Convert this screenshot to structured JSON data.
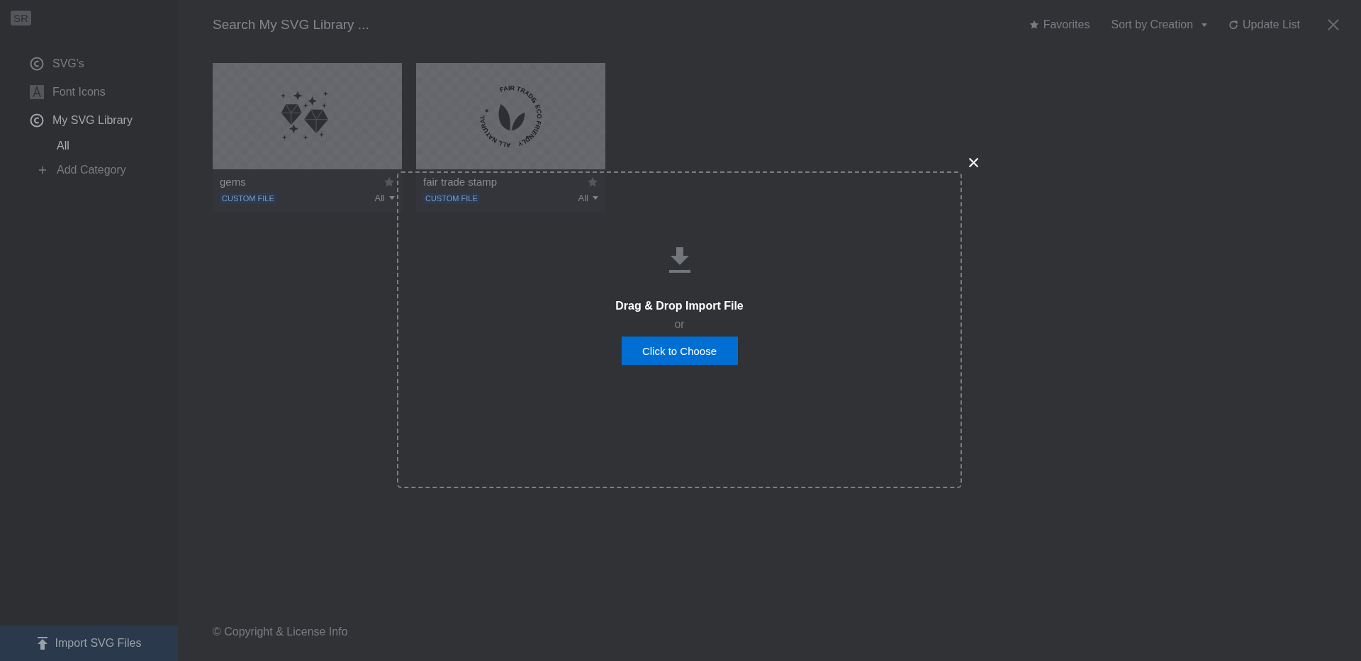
{
  "sidebar": {
    "logo": "SR",
    "nav": [
      {
        "label": "SVG's",
        "kind": "copyright",
        "selected": false
      },
      {
        "label": "Font Icons",
        "kind": "font",
        "selected": false
      },
      {
        "label": "My SVG Library",
        "kind": "copyright",
        "selected": true,
        "children": [
          {
            "label": "All",
            "selected": true
          }
        ]
      }
    ],
    "add_category": "Add Category",
    "import_button": "Import SVG Files"
  },
  "toolbar": {
    "search": {
      "placeholder": "Search My SVG Library ..."
    },
    "favorites": "Favorites",
    "sort": "Sort by Creation",
    "update": "Update List"
  },
  "cards": [
    {
      "name": "gems",
      "kind": "gems",
      "badge": "CUSTOM FILE",
      "category": "All",
      "favorite": false
    },
    {
      "name": "fair trade stamp",
      "kind": "stamp",
      "stamp_texts": [
        "ALL NATURAL",
        "FAIR TRADE",
        "ECO FRIENDLY"
      ],
      "badge": "CUSTOM FILE",
      "category": "All",
      "favorite": false
    }
  ],
  "footer": "© Copyright & License Info",
  "import_dialog": {
    "title": "Drag & Drop Import File",
    "or": "or",
    "button": "Click to Choose"
  }
}
